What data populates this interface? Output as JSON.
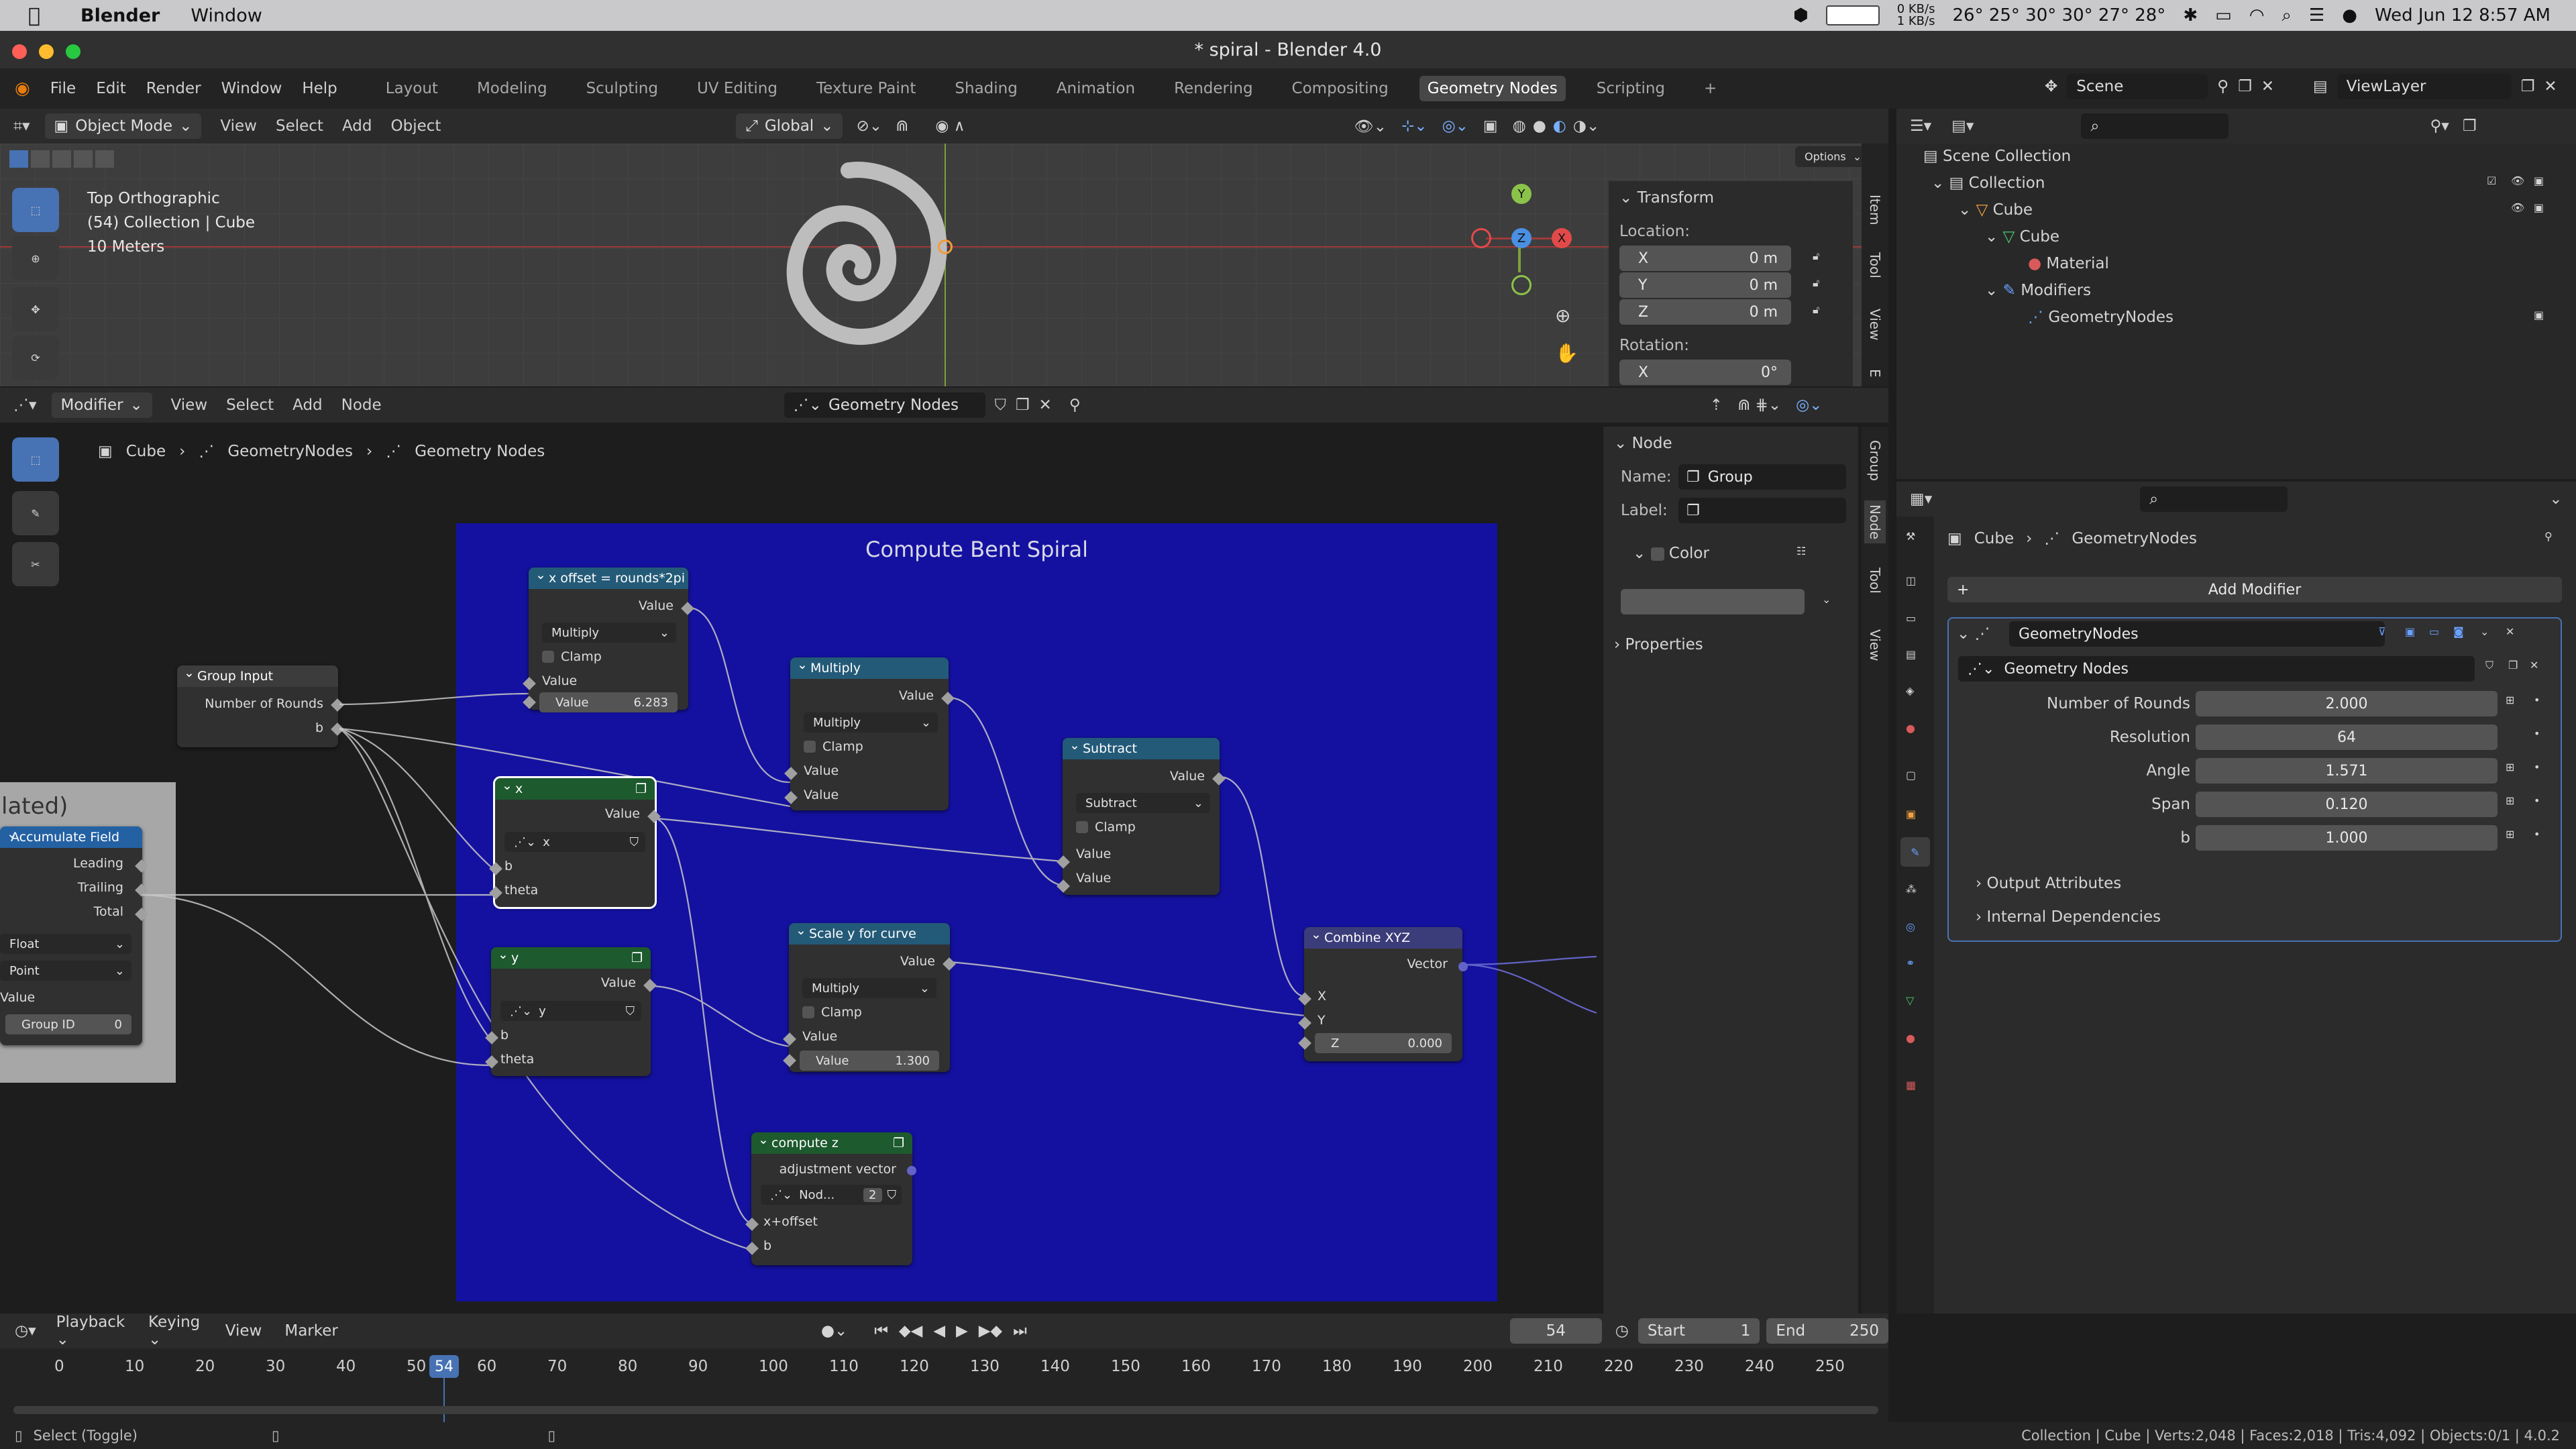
{
  "macos": {
    "app": "Blender",
    "menu": [
      "Window"
    ],
    "net": "0 KB/s\n1 KB/s",
    "temps": "26° 25° 30° 30° 27° 28°",
    "datetime": "Wed Jun 12  8:57 AM"
  },
  "window": {
    "title": "* spiral - Blender 4.0"
  },
  "topmenu": [
    "File",
    "Edit",
    "Render",
    "Window",
    "Help"
  ],
  "workspaces": [
    "Layout",
    "Modeling",
    "Sculpting",
    "UV Editing",
    "Texture Paint",
    "Shading",
    "Animation",
    "Rendering",
    "Compositing",
    "Geometry Nodes",
    "Scripting"
  ],
  "active_workspace": "Geometry Nodes",
  "scene": "Scene",
  "viewlayer": "ViewLayer",
  "viewport": {
    "mode": "Object Mode",
    "menus": [
      "View",
      "Select",
      "Add",
      "Object"
    ],
    "orientation": "Global",
    "options": "Options",
    "overlay_text": [
      "Top Orthographic",
      "(54) Collection | Cube",
      "10 Meters"
    ],
    "tabs": [
      "Item",
      "Tool",
      "View"
    ],
    "tab_cut": "E",
    "transform": {
      "header": "Transform",
      "location_label": "Location:",
      "x": "0 m",
      "y": "0 m",
      "z": "0 m",
      "rotation_label": "Rotation:",
      "rx": "0°"
    },
    "gizmo": {
      "x": "X",
      "y": "Y",
      "z": "Z"
    }
  },
  "outliner": {
    "items": [
      {
        "label": "Scene Collection"
      },
      {
        "label": "Collection"
      },
      {
        "label": "Cube"
      },
      {
        "label": "Cube"
      },
      {
        "label": "Material"
      },
      {
        "label": "Modifiers"
      },
      {
        "label": "GeometryNodes"
      }
    ]
  },
  "properties": {
    "breadcrumb": [
      "Cube",
      "GeometryNodes"
    ],
    "add_modifier": "Add Modifier",
    "modifier_name": "GeometryNodes",
    "nodegroup": "Geometry Nodes",
    "params": [
      {
        "label": "Number of Rounds",
        "value": "2.000"
      },
      {
        "label": "Resolution",
        "value": "64"
      },
      {
        "label": "Angle",
        "value": "1.571"
      },
      {
        "label": "Span",
        "value": "0.120"
      },
      {
        "label": "b",
        "value": "1.000"
      }
    ],
    "sections": [
      "Output Attributes",
      "Internal Dependencies"
    ]
  },
  "node_editor": {
    "header_mode": "Modifier",
    "menus": [
      "View",
      "Select",
      "Add",
      "Node"
    ],
    "tree_name": "Geometry Nodes",
    "breadcrumb": [
      "Cube",
      "GeometryNodes",
      "Geometry Nodes"
    ],
    "frame_label": "Compute Bent Spiral",
    "side_tabs": [
      "Group",
      "Node",
      "Tool",
      "View"
    ],
    "n_panel": {
      "header": "Node",
      "name_label": "Name:",
      "name_value": "Group",
      "label_label": "Label:",
      "color_label": "Color",
      "properties": "Properties"
    },
    "nodes": {
      "group_input": {
        "title": "Group Input",
        "out1": "Number of Rounds",
        "out2": "b"
      },
      "accumulate": {
        "title": "Accumulate Field",
        "frame_text": "lated)",
        "leading": "Leading",
        "trailing": "Trailing",
        "total": "Total",
        "dtype": "Float",
        "domain": "Point",
        "value": "Value",
        "group_id": "Group ID",
        "group_id_val": "0"
      },
      "xoffset": {
        "title": "x offset = rounds*2pi",
        "out": "Value",
        "op": "Multiply",
        "clamp": "Clamp",
        "in1": "Value",
        "in2_label": "Value",
        "in2_val": "6.283"
      },
      "multiply": {
        "title": "Multiply",
        "out": "Value",
        "op": "Multiply",
        "clamp": "Clamp",
        "in1": "Value",
        "in2": "Value"
      },
      "subtract": {
        "title": "Subtract",
        "out": "Value",
        "op": "Subtract",
        "clamp": "Clamp",
        "in1": "Value",
        "in2": "Value"
      },
      "x": {
        "title": "x",
        "out": "Value",
        "group": "x",
        "in1": "b",
        "in2": "theta"
      },
      "y": {
        "title": "y",
        "out": "Value",
        "group": "y",
        "in1": "b",
        "in2": "theta"
      },
      "scale_y": {
        "title": "Scale y for curve",
        "out": "Value",
        "op": "Multiply",
        "clamp": "Clamp",
        "in1": "Value",
        "in2_label": "Value",
        "in2_val": "1.300"
      },
      "combine": {
        "title": "Combine XYZ",
        "out": "Vector",
        "x": "X",
        "y": "Y",
        "z_label": "Z",
        "z_val": "0.000"
      },
      "compute_z": {
        "title": "compute z",
        "out": "adjustment vector",
        "group": "Nod...",
        "users": "2",
        "in1": "x+offset",
        "in2": "b"
      }
    }
  },
  "timeline": {
    "menus": [
      "Playback",
      "Keying",
      "View",
      "Marker"
    ],
    "current_frame": "54",
    "start_label": "Start",
    "start": "1",
    "end_label": "End",
    "end": "250",
    "ticks": [
      "0",
      "10",
      "20",
      "30",
      "40",
      "50",
      "60",
      "70",
      "80",
      "90",
      "100",
      "110",
      "120",
      "130",
      "140",
      "150",
      "160",
      "170",
      "180",
      "190",
      "200",
      "210",
      "220",
      "230",
      "240",
      "250"
    ]
  },
  "status": {
    "left": "Select (Toggle)",
    "right": "Collection | Cube | Verts:2,048 | Faces:2,018 | Tris:4,092 | Objects:0/1 | 4.0.2"
  },
  "colors": {
    "frame": "#1411a0",
    "math_header": "#235a78",
    "group_header": "#1d5a2e",
    "input_header": "#3c3c3c",
    "accent": "#4772b3",
    "selected_frame": "#5a87d6"
  }
}
